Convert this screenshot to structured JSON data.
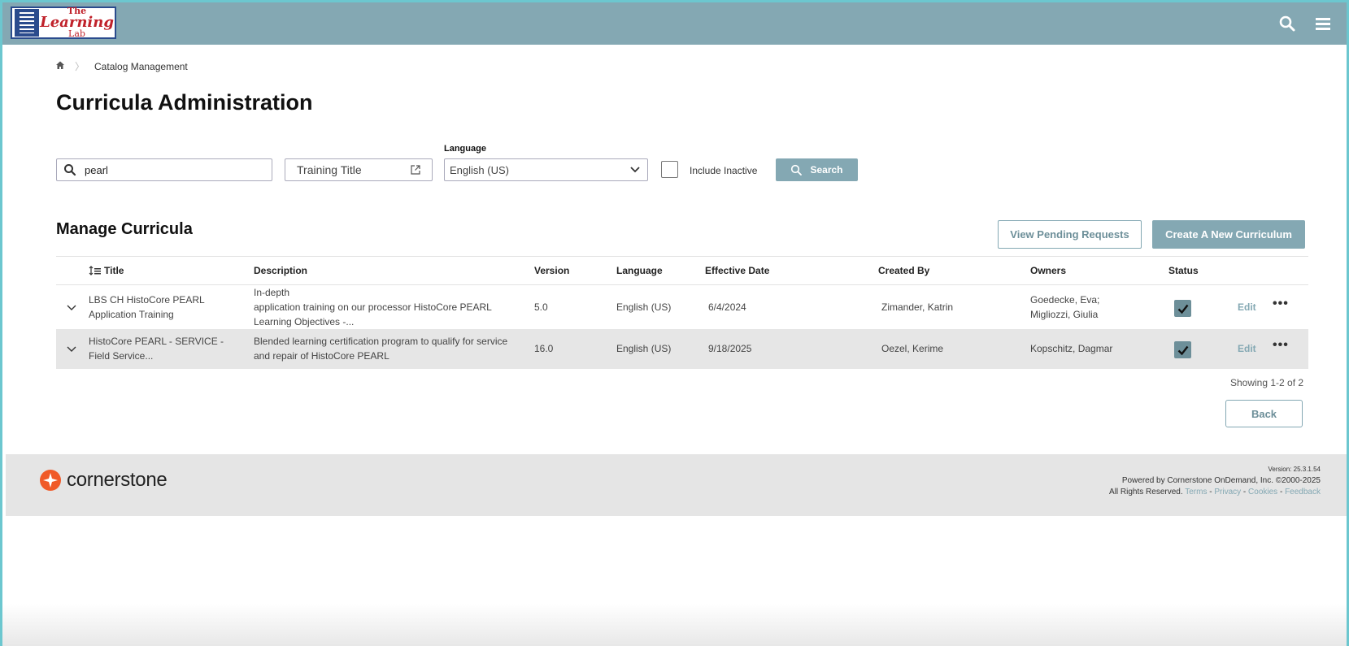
{
  "header": {
    "logo": {
      "line1": "The",
      "line2": "Learning",
      "line3": "Lab"
    },
    "search_icon": "search-icon",
    "menu_icon": "hamburger-menu-icon"
  },
  "breadcrumb": {
    "home_icon": "home-icon",
    "item": "Catalog Management"
  },
  "page_title": "Curricula Administration",
  "filters": {
    "search_value": "pearl",
    "training_title": "Training Title",
    "language_label": "Language",
    "language_value": "English (US)",
    "include_inactive_label": "Include Inactive",
    "search_button": "Search"
  },
  "manage": {
    "title": "Manage Curricula",
    "view_pending": "View Pending Requests",
    "create_new": "Create A New Curriculum"
  },
  "table": {
    "columns": {
      "title": "Title",
      "description": "Description",
      "version": "Version",
      "language": "Language",
      "effective_date": "Effective Date",
      "created_by": "Created By",
      "owners": "Owners",
      "status": "Status"
    },
    "rows": [
      {
        "title": "LBS CH HistoCore PEARL Application Training",
        "description": "In-depth\n  application training on our processor    HistoCore PEARL\nLearning Objectives    -...",
        "version": "5.0",
        "language": "English (US)",
        "effective_date": "6/4/2024",
        "created_by": "Zimander, Katrin",
        "owners": "Goedecke, Eva;\nMigliozzi, Giulia",
        "edit": "Edit"
      },
      {
        "title": "HistoCore PEARL - SERVICE - Field Service...",
        "description": "Blended learning certification program to qualify for service and repair of HistoCore PEARL",
        "version": "16.0",
        "language": "English (US)",
        "effective_date": "9/18/2025",
        "created_by": "Oezel, Kerime",
        "owners": "Kopschitz, Dagmar",
        "edit": "Edit"
      }
    ],
    "showing": "Showing 1-2 of 2",
    "back": "Back"
  },
  "footer": {
    "brand": "cornerstone",
    "version": "Version: 25.3.1.54",
    "powered": "Powered by Cornerstone OnDemand, Inc. ©2000-2025",
    "rights": "All Rights Reserved.",
    "terms": "Terms",
    "privacy": "Privacy",
    "cookies": "Cookies",
    "feedback": "Feedback"
  },
  "colors": {
    "accent": "#84a8b3",
    "accent_dark": "#6d8f99",
    "brand_orange": "#f05a28"
  }
}
